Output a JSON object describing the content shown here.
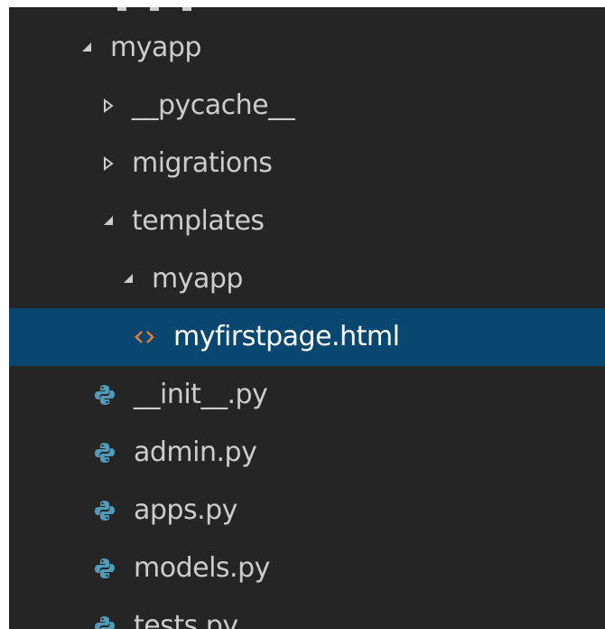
{
  "tree": {
    "root_folder": {
      "label": "myapp",
      "expanded": true,
      "icon": "expanded-chevron-icon"
    },
    "items": [
      {
        "label": "__pycache__",
        "kind": "folder",
        "expanded": false,
        "icon": "collapsed-chevron-icon"
      },
      {
        "label": "migrations",
        "kind": "folder",
        "expanded": false,
        "icon": "collapsed-chevron-icon"
      },
      {
        "label": "templates",
        "kind": "folder",
        "expanded": true,
        "icon": "expanded-chevron-icon"
      },
      {
        "label": "myapp",
        "kind": "folder",
        "expanded": true,
        "icon": "expanded-chevron-icon"
      },
      {
        "label": "myfirstpage.html",
        "kind": "html-file",
        "selected": true,
        "icon": "html-file-icon"
      },
      {
        "label": "__init__.py",
        "kind": "python-file",
        "icon": "python-file-icon"
      },
      {
        "label": "admin.py",
        "kind": "python-file",
        "icon": "python-file-icon"
      },
      {
        "label": "apps.py",
        "kind": "python-file",
        "icon": "python-file-icon"
      },
      {
        "label": "models.py",
        "kind": "python-file",
        "icon": "python-file-icon"
      },
      {
        "label": "tests.py",
        "kind": "python-file",
        "icon": "python-file-icon"
      }
    ]
  },
  "colors": {
    "panel_background": "#252526",
    "text": "#cccccc",
    "selection_background": "#094771",
    "selection_text": "#ffffff",
    "html_icon": "#e37933",
    "python_icon": "#519aba"
  }
}
